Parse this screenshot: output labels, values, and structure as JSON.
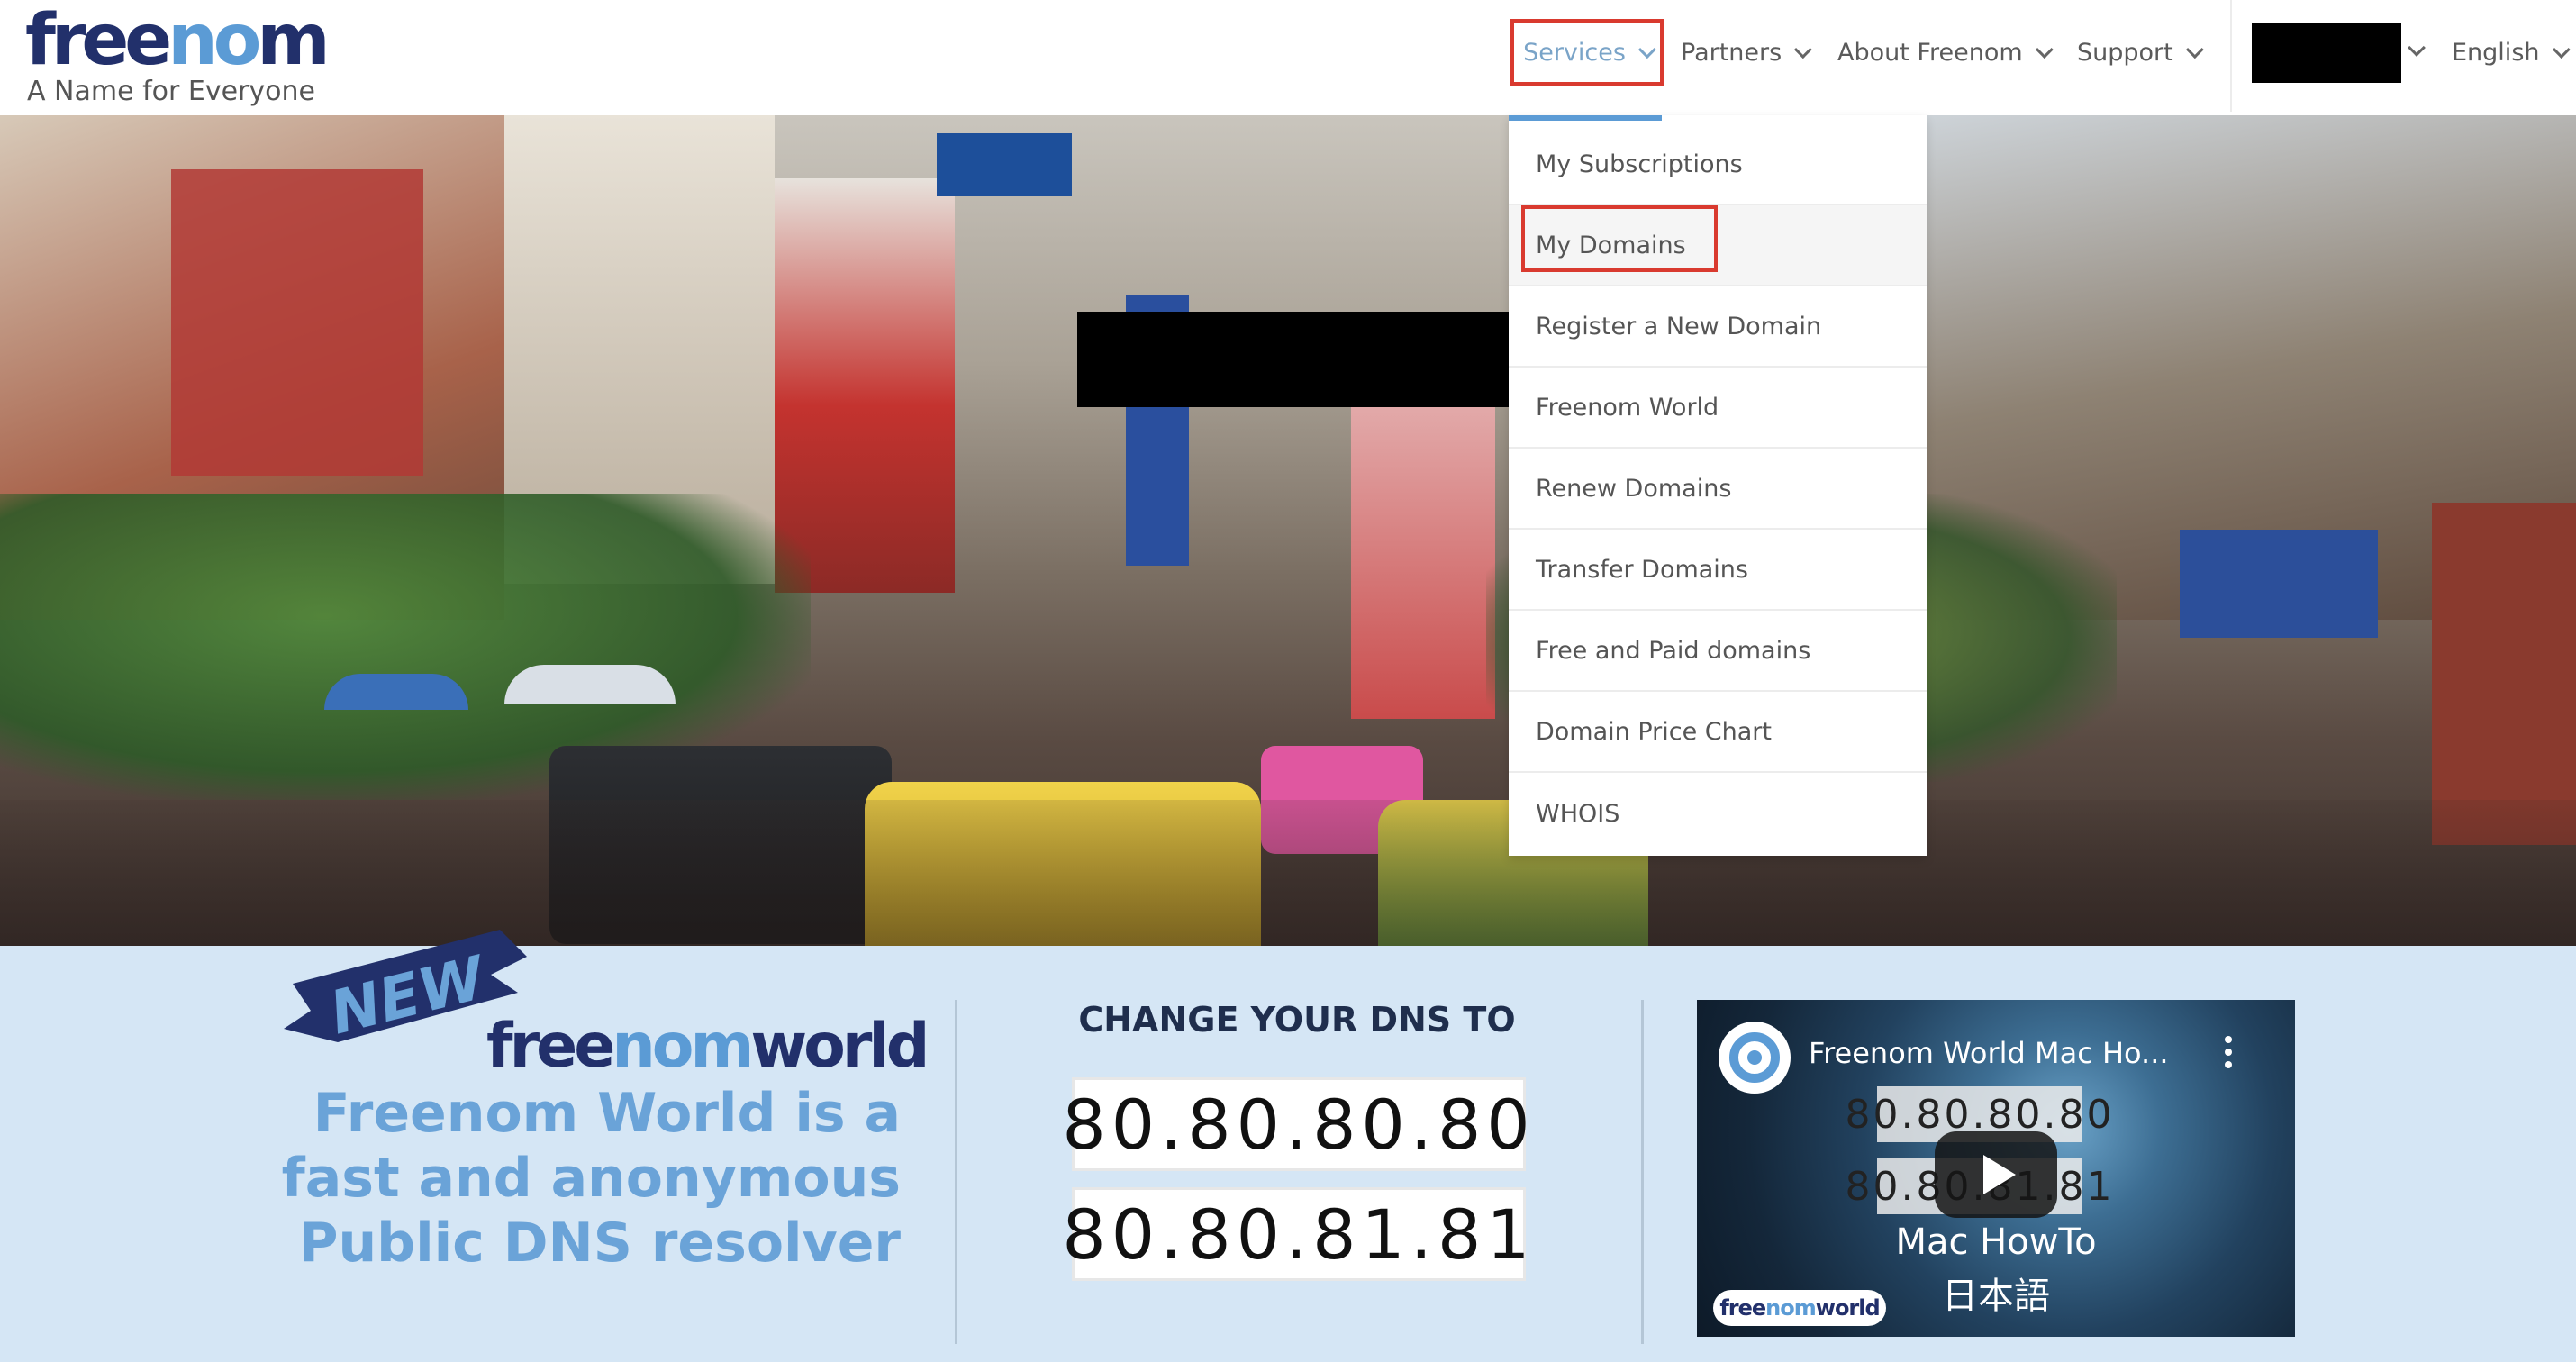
{
  "header": {
    "logo": {
      "part1": "free",
      "part2": "no",
      "part3": "m",
      "tagline": "A Name for Everyone"
    },
    "nav": [
      {
        "label": "Services"
      },
      {
        "label": "Partners"
      },
      {
        "label": "About Freenom"
      },
      {
        "label": "Support"
      }
    ],
    "language": "English"
  },
  "dropdown": {
    "items": [
      {
        "label": "My Subscriptions"
      },
      {
        "label": "My Domains"
      },
      {
        "label": "Register a New Domain"
      },
      {
        "label": "Freenom World"
      },
      {
        "label": "Renew Domains"
      },
      {
        "label": "Transfer Domains"
      },
      {
        "label": "Free and Paid domains"
      },
      {
        "label": "Domain Price Chart"
      },
      {
        "label": "WHOIS"
      }
    ]
  },
  "promo": {
    "badge": "NEW",
    "logo": {
      "part1": "free",
      "part2": "nom",
      "part3": "world"
    },
    "description_lines": [
      "Freenom World is a",
      "fast and anonymous",
      "Public DNS resolver"
    ],
    "dns_title": "CHANGE YOUR DNS TO",
    "dns": [
      "80.80.80.80",
      "80.80.81.81"
    ]
  },
  "video": {
    "title": "Freenom World Mac Ho...",
    "overlay_dns": [
      "80.80.80.80",
      "80.80.81.81"
    ],
    "caption_1": "Mac HowTo",
    "caption_2": "日本語",
    "badge": {
      "part1": "free",
      "part2": "nom",
      "part3": "world"
    }
  },
  "colors": {
    "accent": "#5b9bd5",
    "brand_dark": "#22306b",
    "highlight_box": "#d93a2f",
    "promo_bg": "#d5e6f5"
  },
  "icons": [
    "chevron-down-icon",
    "play-icon",
    "more-options-icon",
    "channel-logo-icon"
  ]
}
